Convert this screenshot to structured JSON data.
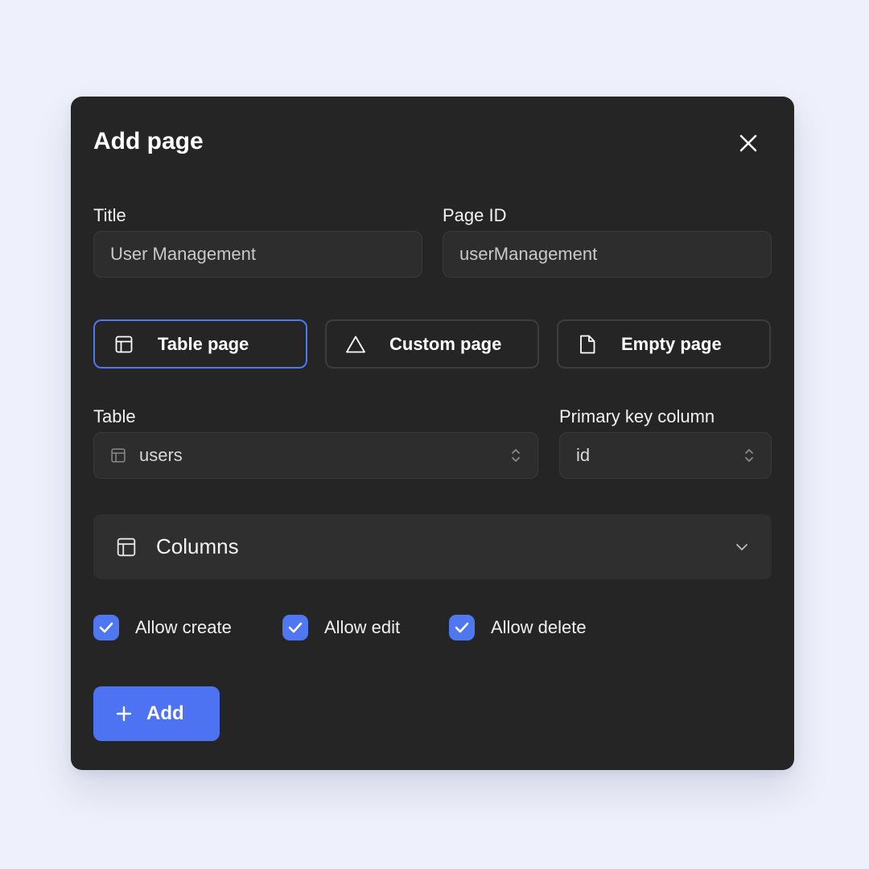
{
  "dialog": {
    "title": "Add page",
    "close_icon": "close-icon"
  },
  "fields": {
    "title": {
      "label": "Title",
      "value": "User Management"
    },
    "page_id": {
      "label": "Page ID",
      "value": "userManagement"
    }
  },
  "page_types": [
    {
      "label": "Table page",
      "icon": "table-icon",
      "selected": true
    },
    {
      "label": "Custom page",
      "icon": "triangle-icon",
      "selected": false
    },
    {
      "label": "Empty page",
      "icon": "file-icon",
      "selected": false
    }
  ],
  "table_select": {
    "label": "Table",
    "value": "users",
    "icon": "table-icon"
  },
  "primary_key_select": {
    "label": "Primary key column",
    "value": "id"
  },
  "columns_section": {
    "label": "Columns",
    "icon": "table-icon",
    "expanded": false
  },
  "permissions": [
    {
      "label": "Allow create",
      "checked": true
    },
    {
      "label": "Allow edit",
      "checked": true
    },
    {
      "label": "Allow delete",
      "checked": true
    }
  ],
  "submit": {
    "label": "Add",
    "icon": "plus-icon"
  },
  "colors": {
    "accent": "#4d73f2",
    "selected_border": "#5077ee",
    "modal_bg": "#252525",
    "page_bg": "#eef1fb"
  }
}
